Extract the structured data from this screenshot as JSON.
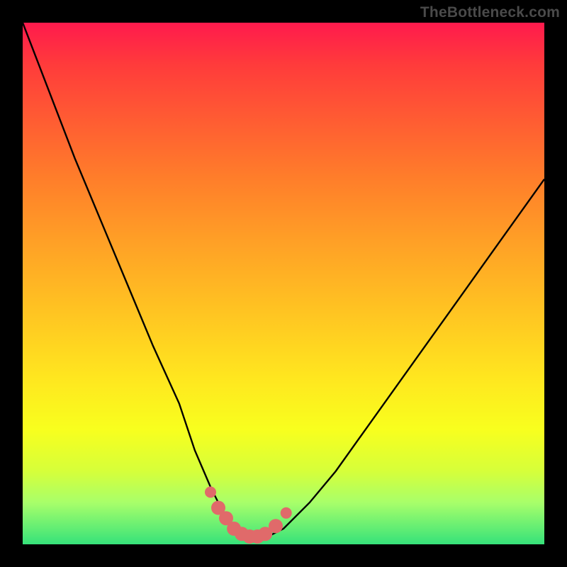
{
  "watermark": "TheBottleneck.com",
  "chart_data": {
    "type": "line",
    "title": "",
    "xlabel": "",
    "ylabel": "",
    "xlim": [
      0,
      100
    ],
    "ylim": [
      0,
      100
    ],
    "grid": false,
    "series": [
      {
        "name": "bottleneck-curve",
        "color": "#000000",
        "x": [
          0,
          5,
          10,
          15,
          20,
          25,
          30,
          33,
          36,
          38,
          40,
          42,
          44,
          46,
          48,
          50,
          55,
          60,
          65,
          70,
          75,
          80,
          85,
          90,
          95,
          100
        ],
        "y": [
          100,
          87,
          74,
          62,
          50,
          38,
          27,
          18,
          11,
          7,
          4,
          2,
          1,
          1,
          2,
          3,
          8,
          14,
          21,
          28,
          35,
          42,
          49,
          56,
          63,
          70
        ]
      },
      {
        "name": "optimal-zone-markers",
        "color": "#e06a6a",
        "type": "scatter",
        "x": [
          36,
          37.5,
          39,
          40.5,
          42,
          43.5,
          45,
          46.5,
          48.5,
          50.5
        ],
        "y": [
          10,
          7,
          5,
          3,
          2,
          1.5,
          1.5,
          2,
          3.5,
          6
        ]
      }
    ],
    "annotations": []
  },
  "colors": {
    "frame": "#000000",
    "gradient_top": "#ff1a4d",
    "gradient_mid": "#ffe61f",
    "gradient_bottom": "#36e27a",
    "curve": "#000000",
    "markers": "#e06a6a",
    "watermark": "#4a4a4a"
  }
}
